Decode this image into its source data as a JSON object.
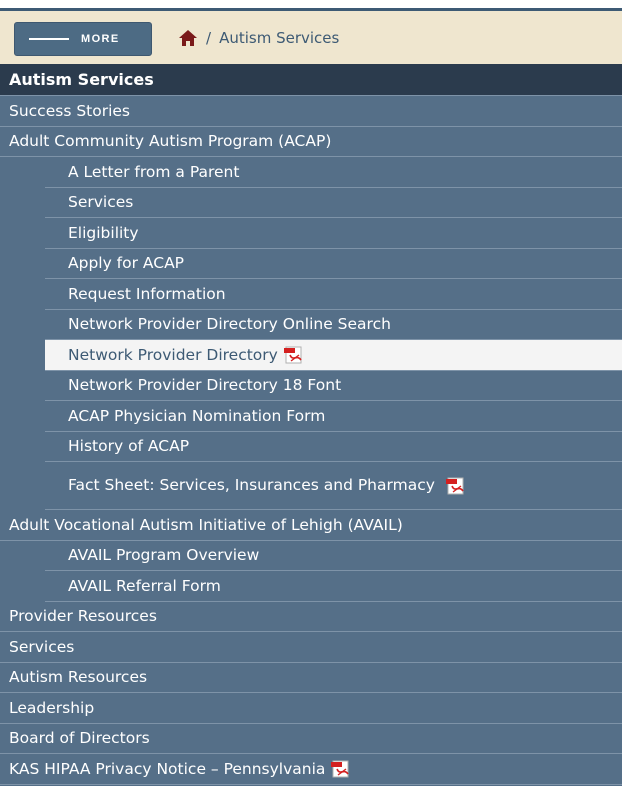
{
  "topbar": {
    "more_label": "MORE",
    "breadcrumb_separator": "/",
    "breadcrumb_current": "Autism Services"
  },
  "nav": {
    "header": "Autism Services",
    "items": [
      {
        "label": "Success Stories"
      },
      {
        "label": "Adult Community Autism Program (ACAP)"
      }
    ],
    "acap_children": [
      {
        "label": "A Letter from a Parent"
      },
      {
        "label": "Services"
      },
      {
        "label": "Eligibility"
      },
      {
        "label": "Apply for ACAP"
      },
      {
        "label": "Request Information"
      },
      {
        "label": "Network Provider Directory Online Search"
      },
      {
        "label": "Network Provider Directory",
        "pdf": true,
        "active": true
      },
      {
        "label": "Network Provider Directory 18 Font"
      },
      {
        "label": "ACAP Physician Nomination Form"
      },
      {
        "label": "History of ACAP"
      },
      {
        "label": "Fact Sheet: Services, Insurances and Pharmacy",
        "pdf": true
      }
    ],
    "avail": {
      "label": "Adult Vocational Autism Initiative of Lehigh (AVAIL)"
    },
    "avail_children": [
      {
        "label": "AVAIL Program Overview"
      },
      {
        "label": "AVAIL Referral Form"
      }
    ],
    "bottom_items": [
      {
        "label": "Provider Resources"
      },
      {
        "label": "Services"
      },
      {
        "label": "Autism Resources"
      },
      {
        "label": "Leadership"
      },
      {
        "label": "Board of Directors"
      },
      {
        "label": "KAS HIPAA Privacy Notice – Pennsylvania",
        "pdf": true
      }
    ]
  },
  "colors": {
    "topbar_bg": "#efe6cf",
    "nav_bg": "#556f88",
    "nav_header_bg": "#2b3b4d",
    "active_bg": "#f4f4f4",
    "link_color": "#3d5a74"
  },
  "icons": {
    "home": "home-icon",
    "pdf": "pdf-icon"
  }
}
